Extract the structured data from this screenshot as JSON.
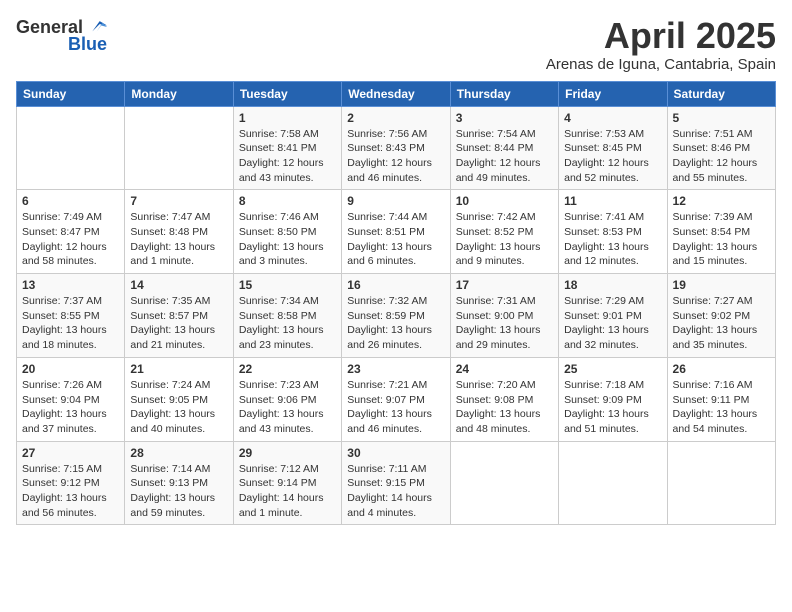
{
  "header": {
    "logo_general": "General",
    "logo_blue": "Blue",
    "title": "April 2025",
    "location": "Arenas de Iguna, Cantabria, Spain"
  },
  "columns": [
    "Sunday",
    "Monday",
    "Tuesday",
    "Wednesday",
    "Thursday",
    "Friday",
    "Saturday"
  ],
  "weeks": [
    [
      {
        "day": "",
        "detail": ""
      },
      {
        "day": "",
        "detail": ""
      },
      {
        "day": "1",
        "detail": "Sunrise: 7:58 AM\nSunset: 8:41 PM\nDaylight: 12 hours and 43 minutes."
      },
      {
        "day": "2",
        "detail": "Sunrise: 7:56 AM\nSunset: 8:43 PM\nDaylight: 12 hours and 46 minutes."
      },
      {
        "day": "3",
        "detail": "Sunrise: 7:54 AM\nSunset: 8:44 PM\nDaylight: 12 hours and 49 minutes."
      },
      {
        "day": "4",
        "detail": "Sunrise: 7:53 AM\nSunset: 8:45 PM\nDaylight: 12 hours and 52 minutes."
      },
      {
        "day": "5",
        "detail": "Sunrise: 7:51 AM\nSunset: 8:46 PM\nDaylight: 12 hours and 55 minutes."
      }
    ],
    [
      {
        "day": "6",
        "detail": "Sunrise: 7:49 AM\nSunset: 8:47 PM\nDaylight: 12 hours and 58 minutes."
      },
      {
        "day": "7",
        "detail": "Sunrise: 7:47 AM\nSunset: 8:48 PM\nDaylight: 13 hours and 1 minute."
      },
      {
        "day": "8",
        "detail": "Sunrise: 7:46 AM\nSunset: 8:50 PM\nDaylight: 13 hours and 3 minutes."
      },
      {
        "day": "9",
        "detail": "Sunrise: 7:44 AM\nSunset: 8:51 PM\nDaylight: 13 hours and 6 minutes."
      },
      {
        "day": "10",
        "detail": "Sunrise: 7:42 AM\nSunset: 8:52 PM\nDaylight: 13 hours and 9 minutes."
      },
      {
        "day": "11",
        "detail": "Sunrise: 7:41 AM\nSunset: 8:53 PM\nDaylight: 13 hours and 12 minutes."
      },
      {
        "day": "12",
        "detail": "Sunrise: 7:39 AM\nSunset: 8:54 PM\nDaylight: 13 hours and 15 minutes."
      }
    ],
    [
      {
        "day": "13",
        "detail": "Sunrise: 7:37 AM\nSunset: 8:55 PM\nDaylight: 13 hours and 18 minutes."
      },
      {
        "day": "14",
        "detail": "Sunrise: 7:35 AM\nSunset: 8:57 PM\nDaylight: 13 hours and 21 minutes."
      },
      {
        "day": "15",
        "detail": "Sunrise: 7:34 AM\nSunset: 8:58 PM\nDaylight: 13 hours and 23 minutes."
      },
      {
        "day": "16",
        "detail": "Sunrise: 7:32 AM\nSunset: 8:59 PM\nDaylight: 13 hours and 26 minutes."
      },
      {
        "day": "17",
        "detail": "Sunrise: 7:31 AM\nSunset: 9:00 PM\nDaylight: 13 hours and 29 minutes."
      },
      {
        "day": "18",
        "detail": "Sunrise: 7:29 AM\nSunset: 9:01 PM\nDaylight: 13 hours and 32 minutes."
      },
      {
        "day": "19",
        "detail": "Sunrise: 7:27 AM\nSunset: 9:02 PM\nDaylight: 13 hours and 35 minutes."
      }
    ],
    [
      {
        "day": "20",
        "detail": "Sunrise: 7:26 AM\nSunset: 9:04 PM\nDaylight: 13 hours and 37 minutes."
      },
      {
        "day": "21",
        "detail": "Sunrise: 7:24 AM\nSunset: 9:05 PM\nDaylight: 13 hours and 40 minutes."
      },
      {
        "day": "22",
        "detail": "Sunrise: 7:23 AM\nSunset: 9:06 PM\nDaylight: 13 hours and 43 minutes."
      },
      {
        "day": "23",
        "detail": "Sunrise: 7:21 AM\nSunset: 9:07 PM\nDaylight: 13 hours and 46 minutes."
      },
      {
        "day": "24",
        "detail": "Sunrise: 7:20 AM\nSunset: 9:08 PM\nDaylight: 13 hours and 48 minutes."
      },
      {
        "day": "25",
        "detail": "Sunrise: 7:18 AM\nSunset: 9:09 PM\nDaylight: 13 hours and 51 minutes."
      },
      {
        "day": "26",
        "detail": "Sunrise: 7:16 AM\nSunset: 9:11 PM\nDaylight: 13 hours and 54 minutes."
      }
    ],
    [
      {
        "day": "27",
        "detail": "Sunrise: 7:15 AM\nSunset: 9:12 PM\nDaylight: 13 hours and 56 minutes."
      },
      {
        "day": "28",
        "detail": "Sunrise: 7:14 AM\nSunset: 9:13 PM\nDaylight: 13 hours and 59 minutes."
      },
      {
        "day": "29",
        "detail": "Sunrise: 7:12 AM\nSunset: 9:14 PM\nDaylight: 14 hours and 1 minute."
      },
      {
        "day": "30",
        "detail": "Sunrise: 7:11 AM\nSunset: 9:15 PM\nDaylight: 14 hours and 4 minutes."
      },
      {
        "day": "",
        "detail": ""
      },
      {
        "day": "",
        "detail": ""
      },
      {
        "day": "",
        "detail": ""
      }
    ]
  ]
}
